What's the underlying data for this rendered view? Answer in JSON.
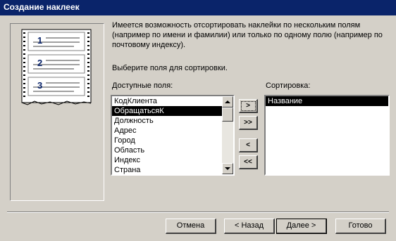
{
  "window": {
    "title": "Создание наклеек"
  },
  "preview": {
    "labels": [
      "1",
      "2",
      "3"
    ]
  },
  "description": [
    "Имеется возможность отсортировать наклейки по нескольким полям",
    "(например по имени и фамилии) или только по одному полю (например по",
    "почтовому индексу)."
  ],
  "prompt": "Выберите поля для сортировки.",
  "available": {
    "label": "Доступные поля:",
    "items": [
      "КодКлиента",
      "ОбращатьсяК",
      "Должность",
      "Адрес",
      "Город",
      "Область",
      "Индекс",
      "Страна"
    ],
    "selected_index": 1
  },
  "sort": {
    "label": "Сортировка:",
    "items": [
      "Название"
    ],
    "selected_index": 0
  },
  "move_buttons": {
    "add": ">",
    "add_all": ">>",
    "remove": "<",
    "remove_all": "<<"
  },
  "buttons": {
    "cancel": "Отмена",
    "back": "< Назад",
    "next": "Далее >",
    "finish": "Готово"
  },
  "colors": {
    "titlebar": "#0a246a",
    "face": "#d4d0c8",
    "selection": "#000000"
  },
  "icons": {
    "scroll_up": "triangle-up",
    "scroll_down": "triangle-down"
  }
}
